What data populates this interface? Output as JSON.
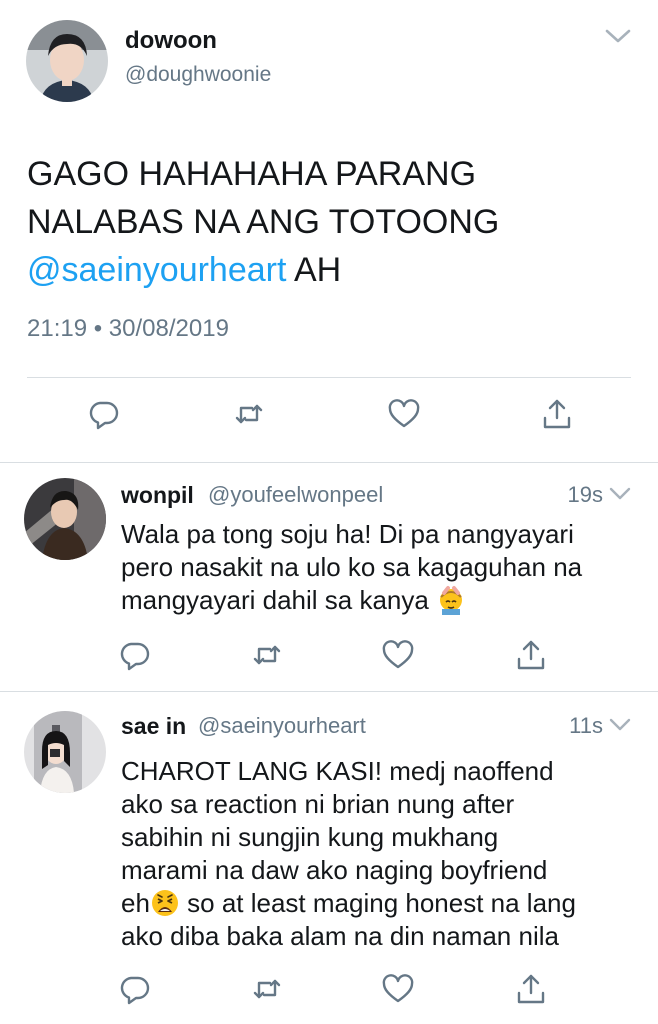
{
  "main_tweet": {
    "display_name": "dowoon",
    "handle": "@doughwoonie",
    "text_line1": "GAGO HAHAHAHA PARANG",
    "text_line2": "NALABAS NA ANG TOTOONG",
    "mention": "@saeinyourheart",
    "text_end": " AH",
    "timestamp": "21:19 • 30/08/2019",
    "actions": [
      "reply-icon",
      "retweet-icon",
      "like-icon",
      "share-icon"
    ]
  },
  "replies": [
    {
      "display_name": "wonpil",
      "handle": "@youfeelwonpeel",
      "time": "19s",
      "line1": "Wala pa tong soju ha! Di pa nangyayari",
      "line2": "pero nasakit na ulo ko sa kagaguhan na",
      "line3": "mangyayari dahil sa kanya",
      "emoji": "person-getting-massage-emoji"
    },
    {
      "display_name": "sae in",
      "handle": "@saeinyourheart",
      "time": "11s",
      "line1": "CHAROT LANG KASI! medj naoffend",
      "line2": "ako sa reaction ni brian nung after",
      "line3": "sabihin ni sungjin kung mukhang",
      "line4": "marami na daw ako naging boyfriend",
      "line5_pre": "eh",
      "line5_post": " so at least maging honest na lang",
      "line6": "ako diba baka alam na din naman nila",
      "emoji": "weary-face-emoji"
    }
  ],
  "colors": {
    "accent": "#1da1f2",
    "secondary_text": "#657786",
    "icon": "#657786"
  }
}
